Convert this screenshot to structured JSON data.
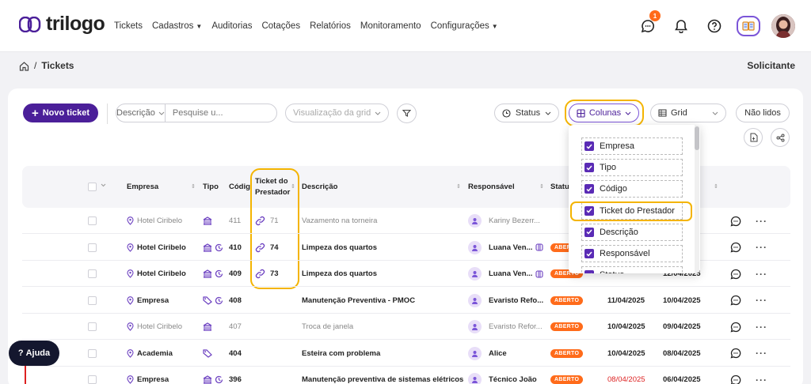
{
  "app": {
    "logo_text": "trilogo",
    "brand_color": "#4b1f99",
    "accent_highlight": "#f4b400"
  },
  "nav": [
    {
      "label": "Tickets",
      "dropdown": false
    },
    {
      "label": "Cadastros",
      "dropdown": true
    },
    {
      "label": "Auditorias",
      "dropdown": false
    },
    {
      "label": "Cotações",
      "dropdown": false
    },
    {
      "label": "Relatórios",
      "dropdown": false
    },
    {
      "label": "Monitoramento",
      "dropdown": false
    },
    {
      "label": "Configurações",
      "dropdown": true
    }
  ],
  "header": {
    "notification_count": "1",
    "icons": [
      "chat-icon",
      "bell-icon",
      "help-icon",
      "ai-book-icon",
      "user-avatar"
    ]
  },
  "breadcrumb": {
    "current": "Tickets",
    "separator": "/"
  },
  "profile_label": "Solicitante",
  "toolbar": {
    "new_ticket": "Novo ticket",
    "search_field": "Descrição",
    "search_placeholder": "Pesquise u...",
    "grid_view": "Visualização da grid",
    "status": "Status",
    "columns": "Colunas",
    "grid": "Grid",
    "unread": "Não lidos"
  },
  "columns_menu": [
    {
      "label": "Empresa",
      "checked": true
    },
    {
      "label": "Tipo",
      "checked": true
    },
    {
      "label": "Código",
      "checked": true
    },
    {
      "label": "Ticket do Prestador",
      "checked": true
    },
    {
      "label": "Descrição",
      "checked": true
    },
    {
      "label": "Responsável",
      "checked": true
    },
    {
      "label": "Status",
      "checked": true
    }
  ],
  "table": {
    "headers": {
      "empresa": "Empresa",
      "tipo": "Tipo",
      "codigo": "Códig",
      "ticket_prestador_1": "Ticket do",
      "ticket_prestador_2": "Prestador",
      "descricao": "Descrição",
      "responsavel": "Responsável",
      "status": "Status"
    },
    "rows": [
      {
        "empresa": "Hotel Ciribelo",
        "tipo": [
          "building"
        ],
        "codigo": "411",
        "prestador": "71",
        "descricao": "Vazamento na torneira",
        "responsavel": "Kariny Bezerr...",
        "status": "",
        "data1": "",
        "data2": "",
        "read": true
      },
      {
        "empresa": "Hotel Ciribelo",
        "tipo": [
          "building",
          "clock"
        ],
        "codigo": "410",
        "prestador": "74",
        "descricao": "Limpeza dos quartos",
        "responsavel": "Luana Ven...",
        "status": "ABERTO",
        "data1": "",
        "data2": "",
        "read": false,
        "extra_icon": true
      },
      {
        "empresa": "Hotel Ciribelo",
        "tipo": [
          "building",
          "clock"
        ],
        "codigo": "409",
        "prestador": "73",
        "descricao": "Limpeza dos quartos",
        "responsavel": "Luana Ven...",
        "status": "ABERTO",
        "data1": "",
        "data2": "12/04/2025",
        "read": false,
        "extra_icon": true
      },
      {
        "empresa": "Empresa",
        "tipo": [
          "tag",
          "clock"
        ],
        "codigo": "408",
        "prestador": "",
        "descricao": "Manutenção Preventiva - PMOC",
        "responsavel": "Evaristo Refo...",
        "status": "ABERTO",
        "data1": "11/04/2025",
        "data2": "10/04/2025",
        "read": false
      },
      {
        "empresa": "Hotel Ciribelo",
        "tipo": [
          "building"
        ],
        "codigo": "407",
        "prestador": "",
        "descricao": "Troca de janela",
        "responsavel": "Evaristo Refor...",
        "status": "ABERTO",
        "data1": "10/04/2025",
        "data2": "09/04/2025",
        "read": true
      },
      {
        "empresa": "Academia",
        "tipo": [
          "tag"
        ],
        "codigo": "404",
        "prestador": "",
        "descricao": "Esteira com problema",
        "responsavel": "Alice",
        "status": "ABERTO",
        "data1": "10/04/2025",
        "data2": "08/04/2025",
        "read": false
      },
      {
        "empresa": "Empresa",
        "tipo": [
          "building",
          "clock"
        ],
        "codigo": "396",
        "prestador": "",
        "descricao": "Manutenção preventiva de sistemas elétricos",
        "responsavel": "Técnico João",
        "status": "ABERTO",
        "data1": "08/04/2025",
        "data2": "06/04/2025",
        "read": false,
        "data1_overdue": true
      }
    ]
  },
  "help_button": "Ajuda"
}
